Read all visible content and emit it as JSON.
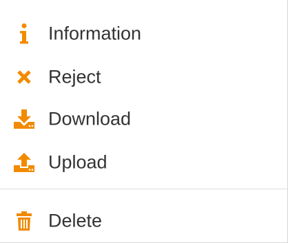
{
  "accent_color": "#f28a00",
  "menu": {
    "items": [
      {
        "label": "Information",
        "icon": "info-icon"
      },
      {
        "label": "Reject",
        "icon": "close-icon"
      },
      {
        "label": "Download",
        "icon": "download-icon"
      },
      {
        "label": "Upload",
        "icon": "upload-icon"
      }
    ],
    "danger_items": [
      {
        "label": "Delete",
        "icon": "trash-icon"
      }
    ]
  }
}
